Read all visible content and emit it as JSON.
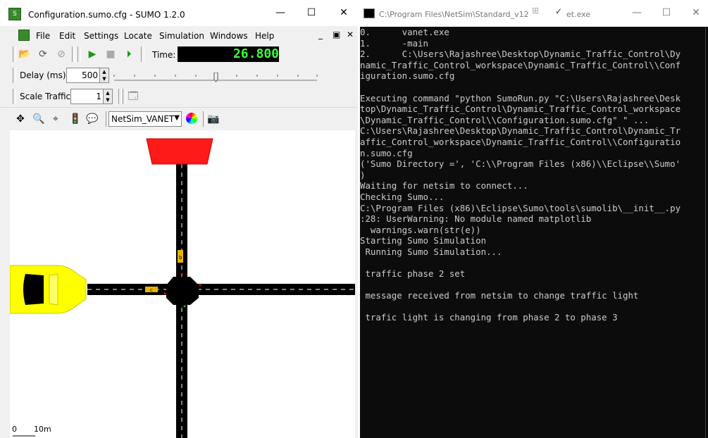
{
  "sumo": {
    "title": "Configuration.sumo.cfg - SUMO 1.2.0",
    "menu": [
      "File",
      "Edit",
      "Settings",
      "Locate",
      "Simulation",
      "Windows",
      "Help"
    ],
    "time_label": "Time:",
    "time_value": "26.800",
    "delay_label": "Delay (ms):",
    "delay_value": "500",
    "scale_label": "Scale Traffic:",
    "scale_value": "1",
    "view_scheme": "NetSim_VANET",
    "scale_bar": {
      "zero": "0",
      "ten": "10m"
    },
    "vehicle_labels": [
      "b",
      "c"
    ]
  },
  "cmd": {
    "title": "C:\\Program Files\\NetSim\\Standard_v12",
    "title_tail": "et.exe",
    "lines": [
      "0.      vanet.exe",
      "1.      -main",
      "2.      C:\\Users\\Rajashree\\Desktop\\Dynamic_Traffic_Control\\Dy",
      "namic_Traffic_Control_workspace\\Dynamic_Traffic_Control\\\\Conf",
      "iguration.sumo.cfg",
      "",
      "Executing command \"python SumoRun.py \"C:\\Users\\Rajashree\\Desk",
      "top\\Dynamic_Traffic_Control\\Dynamic_Traffic_Control_workspace",
      "\\Dynamic_Traffic_Control\\\\Configuration.sumo.cfg\" \" ...",
      "C:\\Users\\Rajashree\\Desktop\\Dynamic_Traffic_Control\\Dynamic_Tr",
      "affic_Control_workspace\\Dynamic_Traffic_Control\\\\Configuratio",
      "n.sumo.cfg",
      "('Sumo Directory =', 'C:\\\\Program Files (x86)\\\\Eclipse\\\\Sumo'",
      ")",
      "Waiting for netsim to connect...",
      "Checking Sumo...",
      "C:\\Program Files (x86)\\Eclipse\\Sumo\\tools\\sumolib\\__init__.py",
      ":28: UserWarning: No module named matplotlib",
      "  warnings.warn(str(e))",
      "Starting Sumo Simulation",
      " Running Sumo Simulation...",
      "",
      " traffic phase 2 set",
      "",
      " message received from netsim to change traffic light",
      "",
      " trafic light is changing from phase 2 to phase 3"
    ]
  },
  "colors": {
    "road": "#000000",
    "vehicle": "#ffff00",
    "signal": "#ff0000",
    "time": "#3cff3c"
  },
  "icons": [
    "sumo-logo-icon",
    "open-icon",
    "reload-icon",
    "close-sim-icon",
    "play-icon",
    "stop-icon",
    "step-icon",
    "locate-icon",
    "zoom-icon",
    "person-icon",
    "tls-icon",
    "poi-icon",
    "color-wheel-icon",
    "screenshot-icon",
    "cmd-icon"
  ]
}
